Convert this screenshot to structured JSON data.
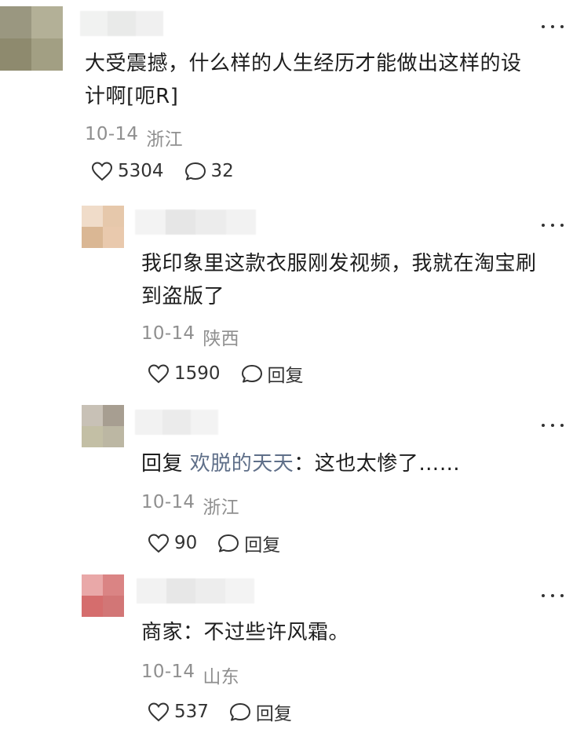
{
  "comments": [
    {
      "text": "大受震撼，什么样的人生经历才能做出这样的设计啊[呃R]",
      "text_line1": "大受震撼，什么样的人生经历才能做出这样的设",
      "text_line2": "计啊[呃R]",
      "date": "10-14",
      "location": "浙江",
      "likes": "5304",
      "reply_count": "32",
      "avatar_colors": [
        "#8d8a72",
        "#b5b296",
        "#9e9a7c",
        "#a7a486"
      ]
    },
    {
      "text_line1": "我印象里这款衣服刚发视频，我就在淘宝刷",
      "text_line2": "到盗版了",
      "date": "10-14",
      "location": "陕西",
      "likes": "1590",
      "reply_label": "回复",
      "avatar_colors": [
        "#f1dcc8",
        "#e7c9ad",
        "#dcb896",
        "#e8c9ac"
      ]
    },
    {
      "reply_prefix": "回复",
      "reply_to": "欢脱的天天",
      "reply_text": "：这也太惨了……",
      "date": "10-14",
      "location": "浙江",
      "likes": "90",
      "reply_label": "回复",
      "avatar_colors": [
        "#c9c2b7",
        "#a9a093",
        "#c4c0a6",
        "#bdb8a5"
      ]
    },
    {
      "text_line1": "商家：不过些许风霜。",
      "date": "10-14",
      "location": "山东",
      "likes": "537",
      "reply_label": "回复",
      "avatar_colors": [
        "#e8a6a6",
        "#d98282",
        "#d66f6f",
        "#d37777"
      ]
    }
  ]
}
